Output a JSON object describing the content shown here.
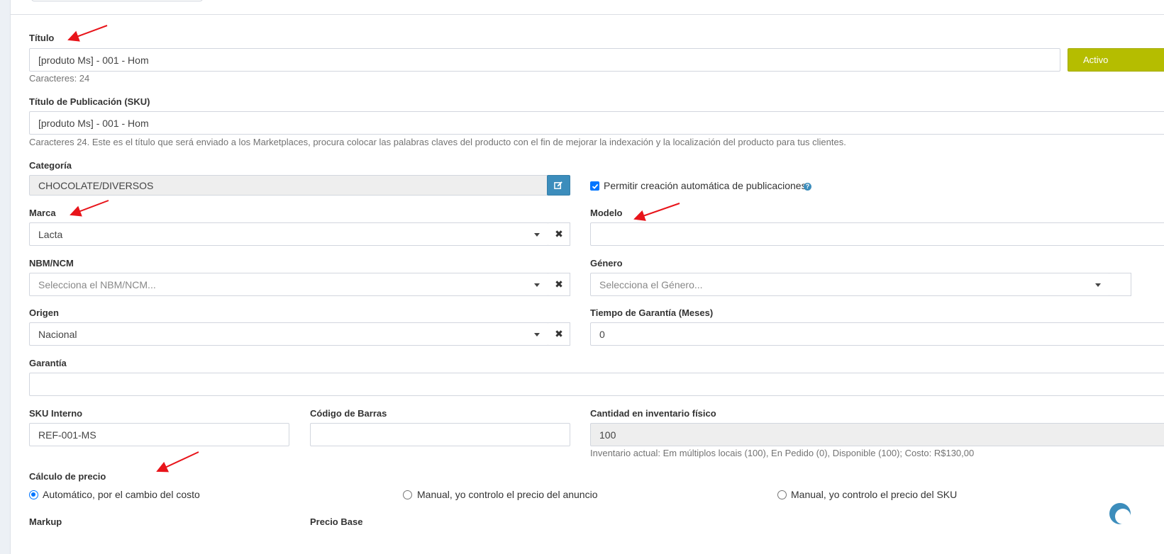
{
  "status_button": {
    "label": "Activo"
  },
  "titulo": {
    "label": "Título",
    "value": "[produto Ms] - 001 - Hom",
    "help": "Caracteres: 24"
  },
  "titulo_publicacion": {
    "label": "Título de Publicación (SKU)",
    "value": "[produto Ms] - 001 - Hom",
    "help": "Caracteres 24. Este es el título que será enviado a los Marketplaces, procura colocar las palabras claves del producto con el fin de mejorar la indexación y la localización del producto para tus clientes."
  },
  "categoria": {
    "label": "Categoría",
    "value": "CHOCOLATE/DIVERSOS"
  },
  "auto_publicaciones": {
    "label": "Permitir creación automática de publicaciones",
    "checked": true
  },
  "marca": {
    "label": "Marca",
    "value": "Lacta"
  },
  "modelo": {
    "label": "Modelo",
    "value": ""
  },
  "nbm": {
    "label": "NBM/NCM",
    "placeholder": "Selecciona el NBM/NCM..."
  },
  "genero": {
    "label": "Género",
    "placeholder": "Selecciona el Género..."
  },
  "origen": {
    "label": "Origen",
    "value": "Nacional"
  },
  "tiempo_garantia": {
    "label": "Tiempo de Garantía (Meses)",
    "value": "0"
  },
  "garantia": {
    "label": "Garantía",
    "value": ""
  },
  "sku_interno": {
    "label": "SKU Interno",
    "value": "REF-001-MS"
  },
  "codigo_barras": {
    "label": "Código de Barras",
    "value": ""
  },
  "inventario": {
    "label": "Cantidad en inventario físico",
    "value": "100",
    "help": "Inventario actual: Em múltiplos locais (100), En Pedido (0), Disponible (100); Costo: R$130,00"
  },
  "calculo_precio": {
    "label": "Cálculo de precio",
    "options": [
      {
        "label": "Automático, por el cambio del costo",
        "selected": true
      },
      {
        "label": "Manual, yo controlo el precio del anuncio",
        "selected": false
      },
      {
        "label": "Manual, yo controlo el precio del SKU",
        "selected": false
      }
    ]
  },
  "markup": {
    "label": "Markup"
  },
  "precio_base": {
    "label": "Precio Base"
  },
  "annotation_color": "#e8141a",
  "accent_colors": {
    "primary": "#3c8dbc",
    "status": "#b5bd00",
    "checkbox": "#0075ff"
  },
  "icons": [
    "edit-icon",
    "caret-down-icon",
    "clear-icon",
    "check-icon",
    "help-icon",
    "annotation-arrow"
  ]
}
